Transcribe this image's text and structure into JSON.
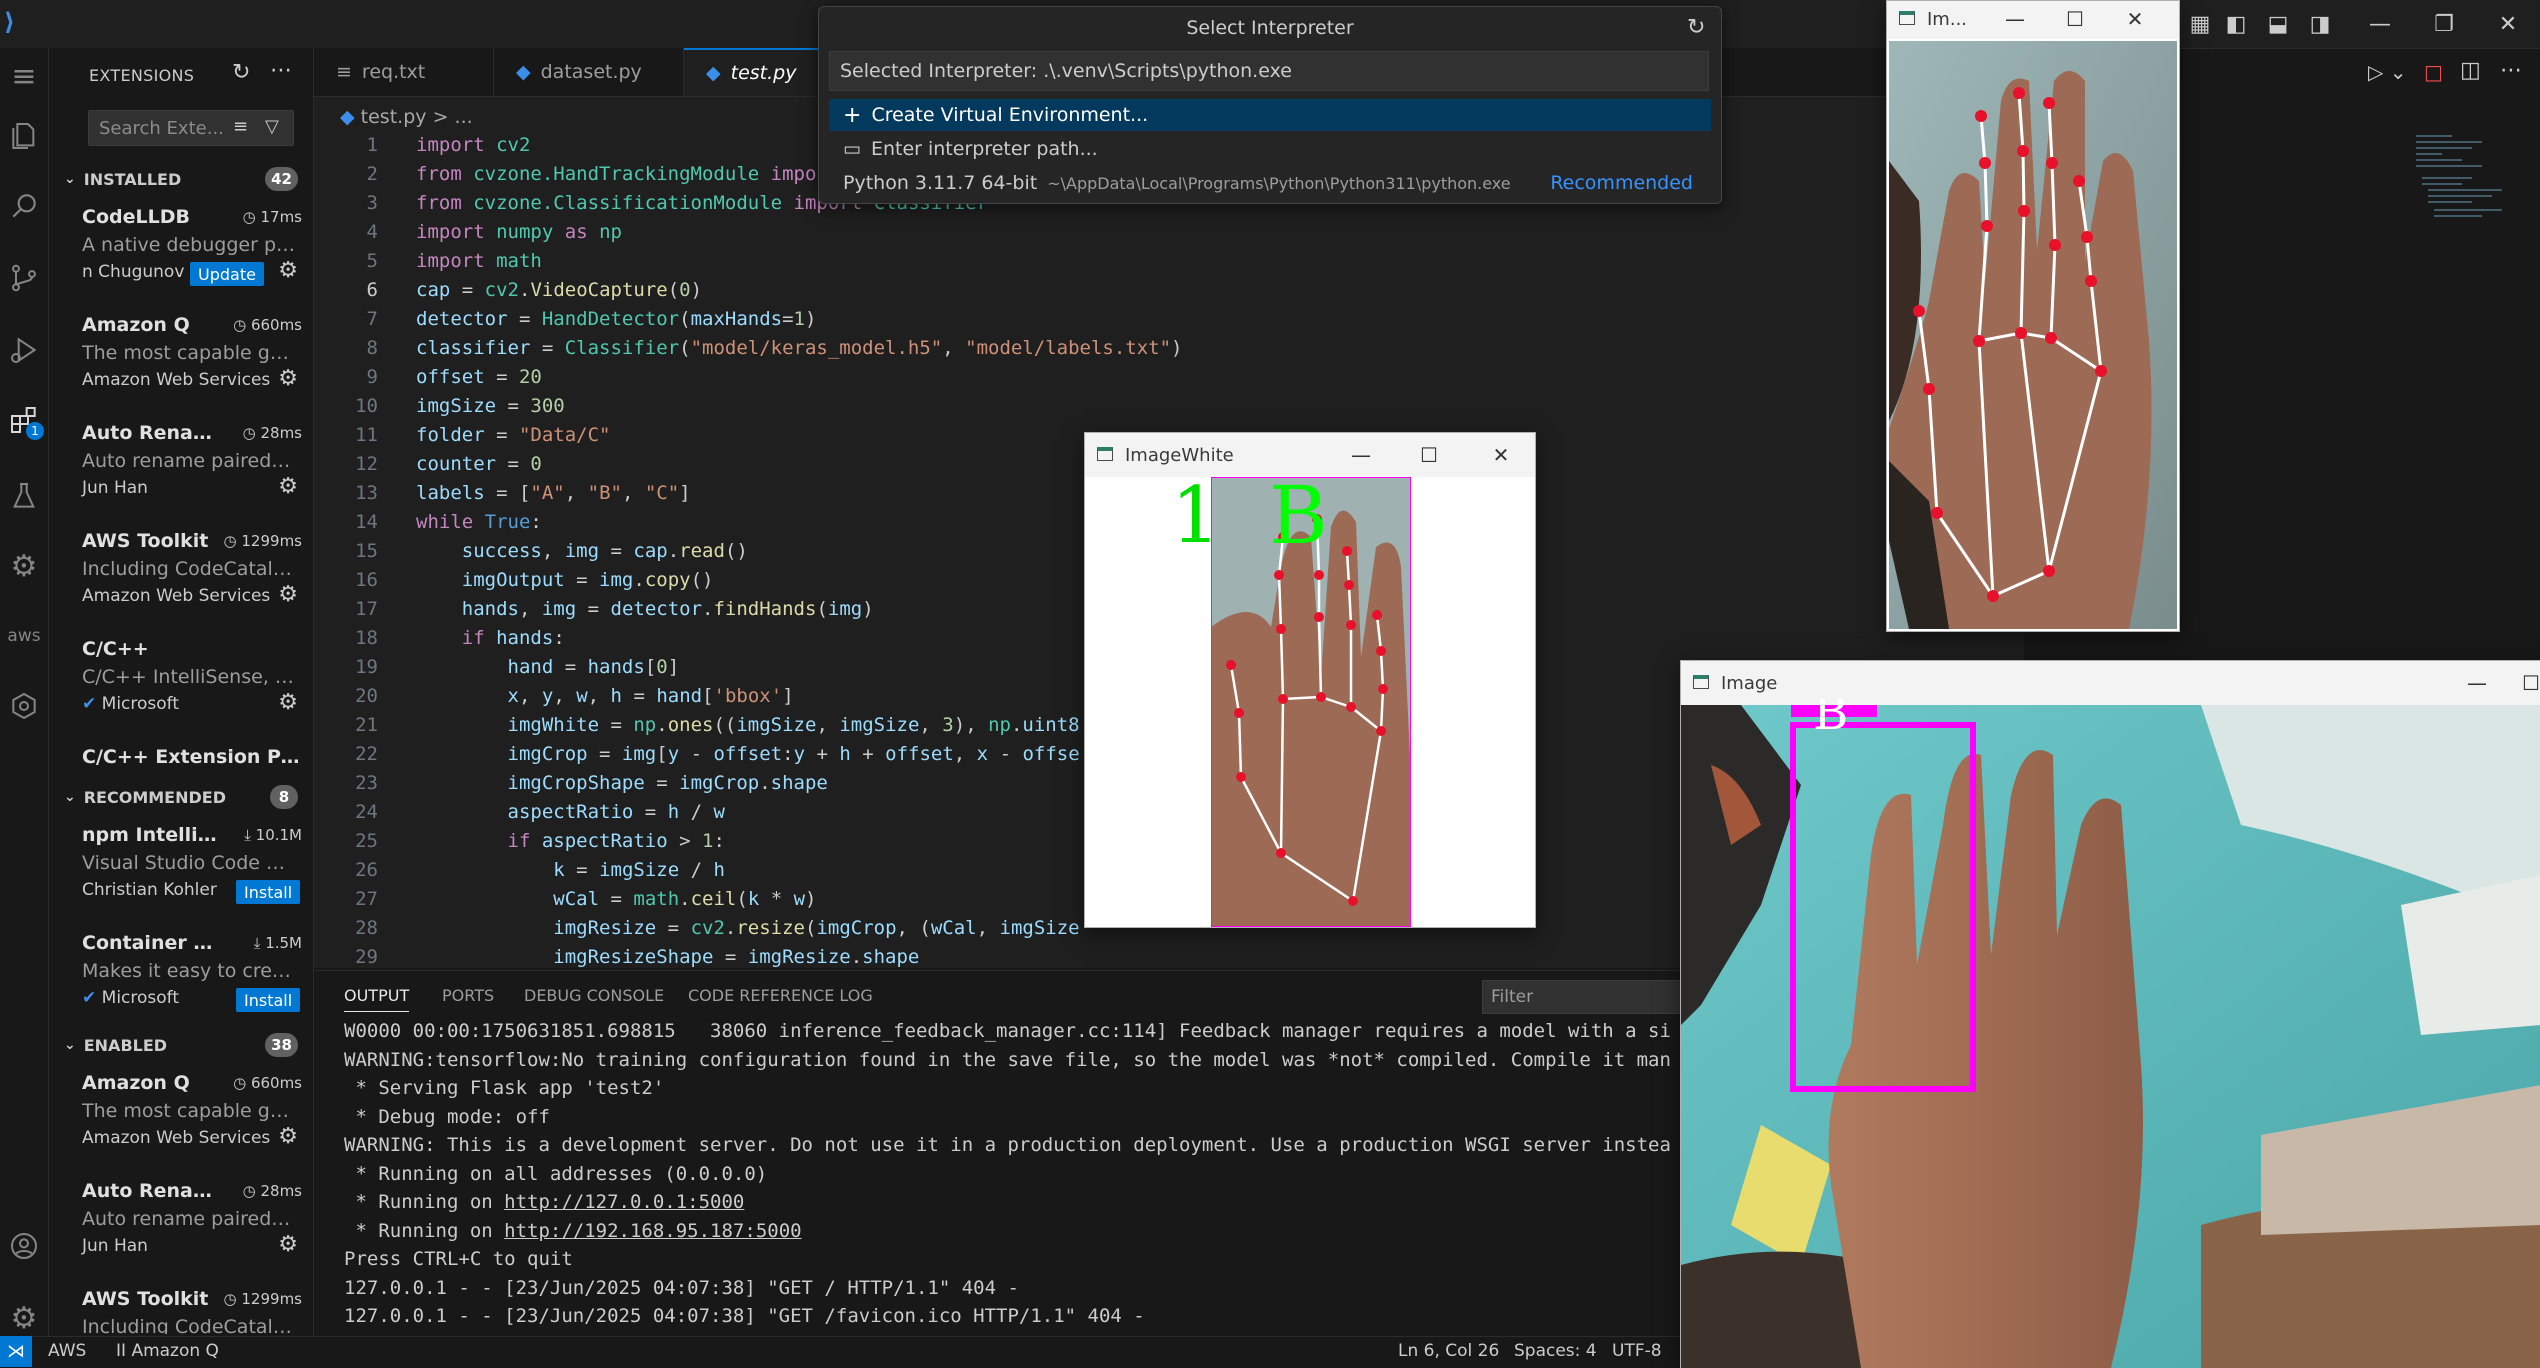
{
  "activity_badge": "1",
  "sidebar": {
    "title": "EXTENSIONS",
    "search_placeholder": "Search Exte...",
    "installed": {
      "label": "INSTALLED",
      "count": "42",
      "items": [
        {
          "name": "CodeLLDB",
          "time": "17ms",
          "desc": "A native debugger po...",
          "pub": "n Chugunov",
          "button": "Update"
        },
        {
          "name": "Amazon Q",
          "time": "660ms",
          "desc": "The most capable gen...",
          "pub": "Amazon Web Services"
        },
        {
          "name": "Auto Rename ...",
          "time": "28ms",
          "desc": "Auto rename paired H...",
          "pub": "Jun Han"
        },
        {
          "name": "AWS Toolkit",
          "time": "1299ms",
          "desc": "Including CodeCatalyst...",
          "pub": "Amazon Web Services"
        },
        {
          "name": "C/C++",
          "time": "",
          "desc": "C/C++ IntelliSense, de...",
          "pub": "Microsoft"
        },
        {
          "name": "C/C++ Extension Pack",
          "time": "",
          "desc": "",
          "pub": ""
        }
      ]
    },
    "recommended": {
      "label": "RECOMMENDED",
      "count": "8",
      "items": [
        {
          "name": "npm Intellis...",
          "time": "10.1M",
          "desc": "Visual Studio Code plu...",
          "pub": "Christian Kohler",
          "button": "Install"
        },
        {
          "name": "Container To...",
          "time": "1.5M",
          "desc": "Makes it easy to create...",
          "pub": "Microsoft",
          "button": "Install"
        }
      ]
    },
    "enabled": {
      "label": "ENABLED",
      "count": "38",
      "items": [
        {
          "name": "Amazon Q",
          "time": "660ms",
          "desc": "The most capable gen...",
          "pub": "Amazon Web Services"
        },
        {
          "name": "Auto Rename ...",
          "time": "28ms",
          "desc": "Auto rename paired H...",
          "pub": "Jun Han"
        },
        {
          "name": "AWS Toolkit",
          "time": "1299ms",
          "desc": "Including CodeCatalyst...",
          "pub": ""
        }
      ]
    }
  },
  "tabs": [
    "req.txt",
    "dataset.py",
    "test.py"
  ],
  "breadcrumb": [
    "test.py",
    "..."
  ],
  "code": {
    "line_numbers": [
      "1",
      "2",
      "3",
      "4",
      "5",
      "6",
      "7",
      "8",
      "9",
      "10",
      "11",
      "12",
      "13",
      "14",
      "15",
      "16",
      "17",
      "18",
      "19",
      "20",
      "21",
      "22",
      "23",
      "24",
      "25",
      "26",
      "27",
      "28",
      "29"
    ],
    "active_line": "6"
  },
  "panel": {
    "tabs": [
      "OUTPUT",
      "PORTS",
      "DEBUG CONSOLE",
      "CODE REFERENCE LOG"
    ],
    "filter_placeholder": "Filter",
    "output": [
      "W0000 00:00:1750631851.698815   38060 inference_feedback_manager.cc:114] Feedback manager requires a model with a si",
      "WARNING:tensorflow:No training configuration found in the save file, so the model was *not* compiled. Compile it man",
      " * Serving Flask app 'test2'",
      " * Debug mode: off",
      "WARNING: This is a development server. Do not use it in a production deployment. Use a production WSGI server instea",
      " * Running on all addresses (0.0.0.0)",
      " * Running on ",
      " * Running on ",
      "Press CTRL+C to quit",
      "127.0.0.1 - - [23/Jun/2025 04:07:38] \"GET / HTTP/1.1\" 404 -",
      "127.0.0.1 - - [23/Jun/2025 04:07:38] \"GET /favicon.ico HTTP/1.1\" 404 -"
    ],
    "link1": "http://127.0.0.1:5000",
    "link2": "http://192.168.95.187:5000"
  },
  "status": {
    "aws": "AWS",
    "amazonq": "Amazon Q",
    "position": "Ln 6, Col 26",
    "spaces": "Spaces: 4",
    "encoding": "UTF-8"
  },
  "quickpick": {
    "title": "Select Interpreter",
    "input": "Selected Interpreter: .\\.venv\\Scripts\\python.exe",
    "create": "Create Virtual Environment...",
    "enter": "Enter interpreter path...",
    "python_label": "Python 3.11.7 64-bit",
    "python_path": "~\\AppData\\Local\\Programs\\Python\\Python311\\python.exe",
    "recommended": "Recommended"
  },
  "windows": {
    "small_title": "Im...",
    "white_title": "ImageWhite",
    "white_counter": "1",
    "white_label": "B",
    "image_title": "Image",
    "image_label": "B"
  },
  "colors": {
    "accent": "#0078d4",
    "bbox": "#ff00ff",
    "landmark": "#e8102a",
    "label_green": "#00ff00"
  }
}
